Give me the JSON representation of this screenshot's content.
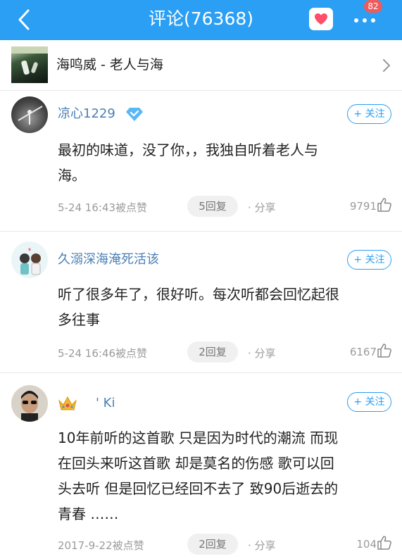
{
  "header": {
    "title": "评论(76368)",
    "badge_count": "82",
    "background_color": "#2b9ff4",
    "heart_color": "#ff4e6a"
  },
  "song": {
    "title": "海鸣威 - 老人与海"
  },
  "follow_label": "+ 关注",
  "comments": [
    {
      "username": "凉心1229",
      "verified_badge": "diamond-badge-icon",
      "text_lines": [
        "最初的味道，没了你，，我独自听着老人与",
        "海。"
      ],
      "time": "5-24 16:43被点赞",
      "reply": "5回复",
      "share": "· 分享",
      "likes": "9791"
    },
    {
      "username": "久溺深海淹死活该",
      "text_lines": [
        "听了很多年了，很好听。每次听都会回忆起很",
        "多往事"
      ],
      "time": "5-24 16:46被点赞",
      "reply": "2回复",
      "share": "· 分享",
      "likes": "6167"
    },
    {
      "username": "' Ki",
      "crown_badge": "crown-icon",
      "text_lines": [
        "10年前听的这首歌  只是因为时代的潮流  而现",
        "在回头来听这首歌  却是莫名的伤感  歌可以回",
        "头去听  但是回忆已经回不去了  致90后逝去的",
        "青春  ……"
      ],
      "time": "2017-9-22被点赞",
      "reply": "2回复",
      "share": "· 分享",
      "likes": "104"
    }
  ]
}
